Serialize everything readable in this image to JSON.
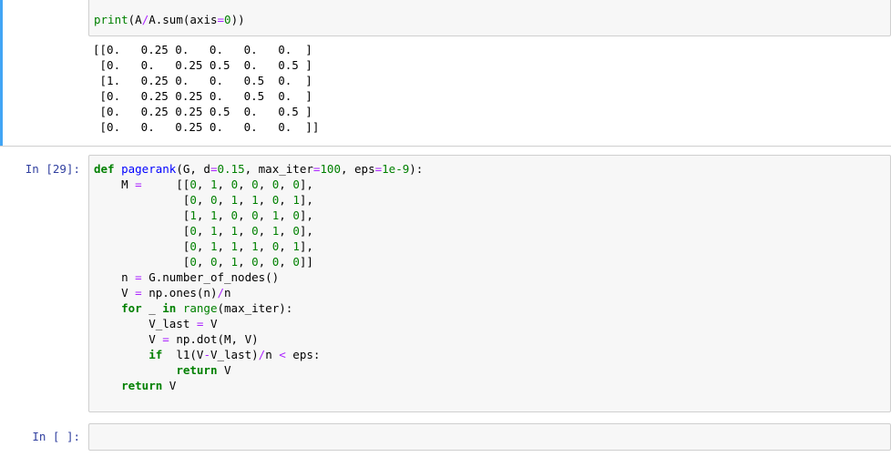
{
  "cell1": {
    "code": "print(A/A.sum(axis=0))",
    "output_lines": [
      "[[0.   0.25 0.   0.   0.   0.  ]",
      " [0.   0.   0.25 0.5  0.   0.5 ]",
      " [1.   0.25 0.   0.   0.5  0.  ]",
      " [0.   0.25 0.25 0.   0.5  0.  ]",
      " [0.   0.25 0.25 0.5  0.   0.5 ]",
      " [0.   0.   0.25 0.   0.   0.  ]]"
    ]
  },
  "cell2": {
    "prompt": "In [29]:",
    "lines": {
      "l1": "def pagerank(G, d=0.15, max_iter=100, eps=1e-9):",
      "l2": "    M =     [[0, 1, 0, 0, 0, 0],",
      "l3": "             [0, 0, 1, 1, 0, 1],",
      "l4": "             [1, 1, 0, 0, 1, 0],",
      "l5": "             [0, 1, 1, 0, 1, 0],",
      "l6": "             [0, 1, 1, 1, 0, 1],",
      "l7": "             [0, 0, 1, 0, 0, 0]]",
      "l8": "    n = G.number_of_nodes()",
      "l9": "    V = np.ones(n)/n",
      "l10": "    for _ in range(max_iter):",
      "l11": "        V_last = V",
      "l12": "        V = np.dot(M, V)",
      "l13": "        if  l1(V-V_last)/n < eps:",
      "l14": "            return V",
      "l15": "    return V"
    }
  },
  "cell3": {
    "prompt": "In [ ]:",
    "code": ""
  }
}
